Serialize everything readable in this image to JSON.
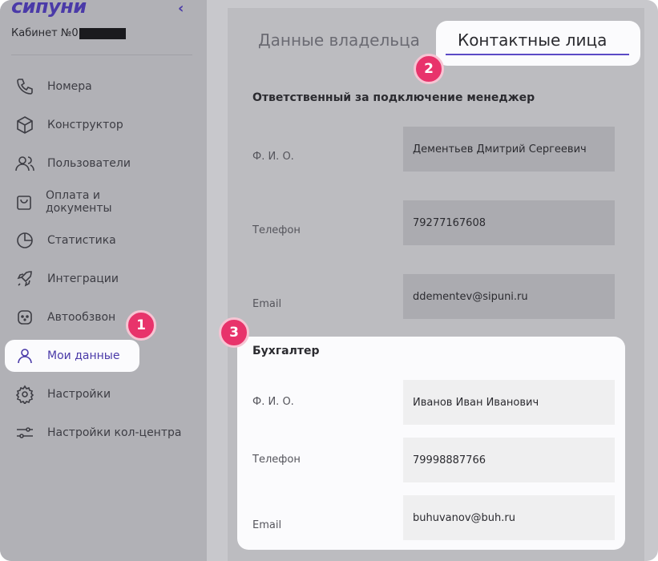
{
  "sidebar": {
    "logo": "сипуни",
    "collapse_icon": "chevron-left-icon",
    "cabinet_label": "Кабинет №0",
    "items": [
      {
        "label": "Номера",
        "icon": "phone-icon"
      },
      {
        "label": "Конструктор",
        "icon": "cube-icon"
      },
      {
        "label": "Пользователи",
        "icon": "users-icon"
      },
      {
        "label": "Оплата и документы",
        "icon": "shopping-bag-icon"
      },
      {
        "label": "Статистика",
        "icon": "pie-chart-icon"
      },
      {
        "label": "Интеграции",
        "icon": "rocket-icon"
      },
      {
        "label": "Автообзвон",
        "icon": "robot-icon"
      },
      {
        "label": "Мои данные",
        "icon": "user-icon",
        "active": true
      },
      {
        "label": "Настройки",
        "icon": "gear-icon"
      },
      {
        "label": "Настройки кол-центра",
        "icon": "sliders-icon"
      }
    ]
  },
  "tabs": {
    "owner": "Данные владельца",
    "contacts": "Контактные лица"
  },
  "badges": [
    "1",
    "2",
    "3"
  ],
  "manager": {
    "title": "Ответственный за подключение менеджер",
    "fio_label": "Ф. И. О.",
    "fio_value": "Дементьев Дмитрий Сергеевич",
    "phone_label": "Телефон",
    "phone_value": "79277167608",
    "email_label": "Email",
    "email_value": "ddementev@sipuni.ru"
  },
  "accountant": {
    "title": "Бухгалтер",
    "fio_label": "Ф. И. О.",
    "fio_value": "Иванов Иван Иванович",
    "phone_label": "Телефон",
    "phone_value": "79998887766",
    "email_label": "Email",
    "email_value": "buhuvanov@buh.ru"
  },
  "colors": {
    "accent": "#4a3aa8",
    "badge": "#e8336b",
    "overlay": "#c8c8cc"
  }
}
